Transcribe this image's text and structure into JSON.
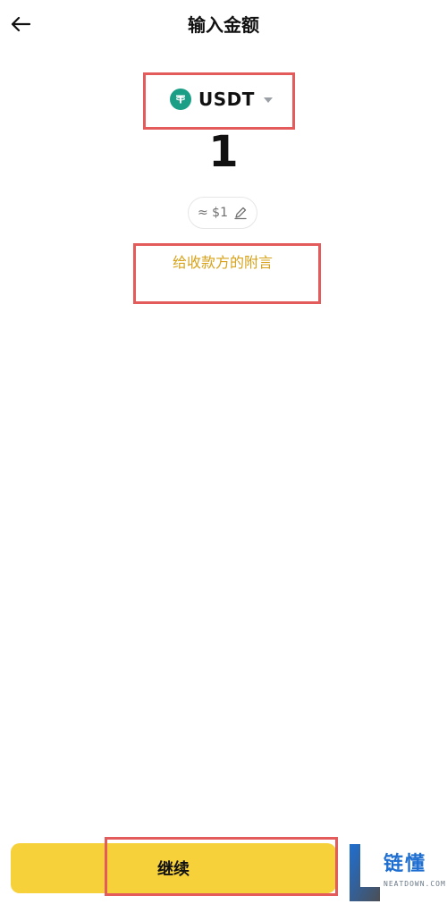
{
  "header": {
    "title": "输入金额",
    "back_icon": "arrow-left-icon"
  },
  "token": {
    "symbol": "USDT",
    "icon": "tether-icon",
    "icon_color": "#1a9e85",
    "dropdown_icon": "chevron-down-icon"
  },
  "amount": {
    "value": "1",
    "usd_estimate": "≈ $1",
    "edit_icon": "pencil-icon"
  },
  "memo": {
    "label": "给收款方的附言",
    "label_color": "#d7a21a"
  },
  "actions": {
    "continue_label": "继续",
    "continue_color": "#f7d13a"
  },
  "watermark": {
    "text": "链懂",
    "subtext": "NEATDOWN.COM"
  }
}
